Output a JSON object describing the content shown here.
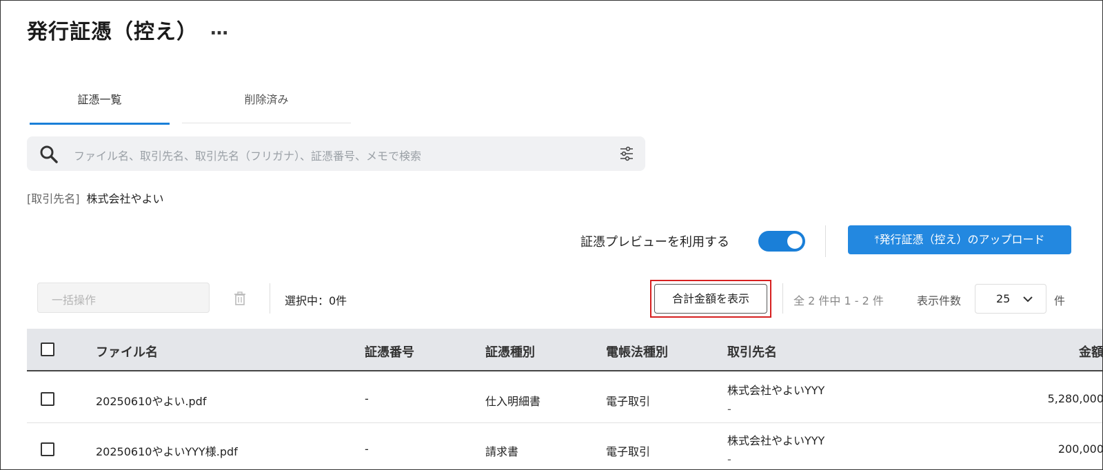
{
  "page": {
    "title": "発行証憑（控え）",
    "more": "…"
  },
  "tabs": [
    {
      "label": "証憑一覧",
      "active": true
    },
    {
      "label": "削除済み",
      "active": false
    }
  ],
  "search": {
    "placeholder": "ファイル名、取引先名、取引先名（フリガナ）、証憑番号、メモで検索"
  },
  "filter": {
    "key": "[取引先名]",
    "value": "株式会社やよい"
  },
  "preview": {
    "label": "証憑プレビューを利用する",
    "enabled": true
  },
  "upload": {
    "label": "⤒発行証憑（控え）のアップロード"
  },
  "toolbar": {
    "bulk_placeholder": "一括操作",
    "selected": "選択中：0件",
    "total_button": "合計金額を表示",
    "range": "全 2 件中 1 - 2 件",
    "per_page_label": "表示件数",
    "per_page_value": "25",
    "per_page_unit": "件"
  },
  "table": {
    "headers": {
      "file": "ファイル名",
      "number": "証憑番号",
      "type": "証憑種別",
      "law": "電帳法種別",
      "client": "取引先名",
      "amount": "金額"
    },
    "rows": [
      {
        "file": "20250610やよい.pdf",
        "number": "-",
        "type": "仕入明細書",
        "law": "電子取引",
        "client": "株式会社やよいYYY",
        "client_sub": "-",
        "amount": "5,280,000"
      },
      {
        "file": "20250610やよいYYY様.pdf",
        "number": "-",
        "type": "請求書",
        "law": "電子取引",
        "client": "株式会社やよいYYY",
        "client_sub": "-",
        "amount": "200,000"
      }
    ]
  },
  "colors": {
    "accent": "#1a7fd8",
    "button": "#2388e0",
    "highlight": "#d61f1f"
  }
}
